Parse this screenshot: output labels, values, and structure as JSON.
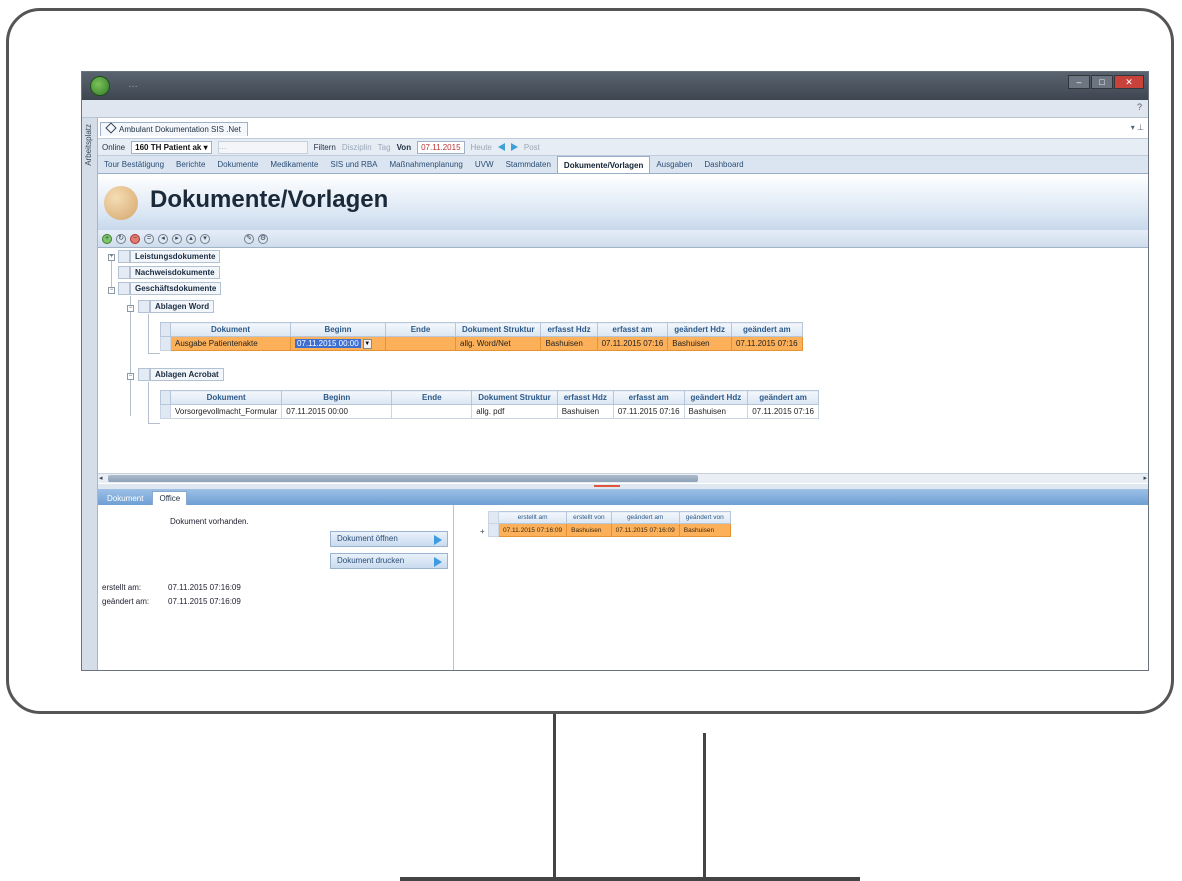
{
  "window": {
    "title_text": "…"
  },
  "ribbon": {
    "help": "?"
  },
  "sidetab": {
    "label": "Arbeitsplatz"
  },
  "doc_tab": {
    "label": "Ambulant Dokumentation SIS .Net"
  },
  "filterbar": {
    "prefix": "Online",
    "patient_value": "160 TH Patient ak",
    "patient_dd": "▾",
    "grayed_value": "…",
    "filter_label": "Filtern",
    "discipline_label": "Disziplin",
    "tag_label": "Tag",
    "von_label": "Von",
    "date_value": "07.11.2015",
    "heute_label": "Heute",
    "post_label": "Post"
  },
  "nav_tabs": [
    {
      "label": "Tour Bestätigung",
      "active": false
    },
    {
      "label": "Berichte",
      "active": false
    },
    {
      "label": "Dokumente",
      "active": false
    },
    {
      "label": "Medikamente",
      "active": false
    },
    {
      "label": "SIS und RBA",
      "active": false
    },
    {
      "label": "Maßnahmenplanung",
      "active": false
    },
    {
      "label": "UVW",
      "active": false
    },
    {
      "label": "Stammdaten",
      "active": false
    },
    {
      "label": "Dokumente/Vorlagen",
      "active": true
    },
    {
      "label": "Ausgaben",
      "active": false
    },
    {
      "label": "Dashboard",
      "active": false
    }
  ],
  "page": {
    "title": "Dokumente/Vorlagen"
  },
  "toolbar": {
    "icons": [
      "add-icon",
      "refresh-icon",
      "delete-icon",
      "print-icon",
      "back-icon",
      "forward-icon",
      "up-icon",
      "down-icon",
      "edit-icon",
      "settings-icon"
    ]
  },
  "tree": {
    "top_nodes": [
      "Leistungsdokumente",
      "Nachweisdokumente",
      "Geschäftsdokumente"
    ],
    "sub_nodes": [
      "Ablagen Word",
      "Ablagen Acrobat"
    ],
    "expander_plus": "+",
    "expander_minus": "−"
  },
  "grid_word": {
    "columns": [
      "Dokument",
      "Beginn",
      "Ende",
      "Dokument Struktur",
      "erfasst Hdz",
      "erfasst am",
      "geändert Hdz",
      "geändert am"
    ],
    "rows": [
      {
        "dokument": "Ausgabe Patientenakte",
        "beginn": "07.11.2015 00:00",
        "ende": "",
        "struktur": "allg. Word/Net",
        "erfasst_hdz": "Bashuisen",
        "erfasst_am": "07.11.2015 07:16",
        "geaendert_hdz": "Bashuisen",
        "geaendert_am": "07.11.2015 07:16"
      }
    ]
  },
  "grid_acrobat": {
    "columns": [
      "Dokument",
      "Beginn",
      "Ende",
      "Dokument Struktur",
      "erfasst Hdz",
      "erfasst am",
      "geändert Hdz",
      "geändert am"
    ],
    "rows": [
      {
        "dokument": "Vorsorgevollmacht_Formular",
        "beginn": "07.11.2015 00:00",
        "ende": "",
        "struktur": "allg. pdf",
        "erfasst_hdz": "Bashuisen",
        "erfasst_am": "07.11.2015 07:16",
        "geaendert_hdz": "Bashuisen",
        "geaendert_am": "07.11.2015 07:16"
      }
    ]
  },
  "bottom_tabs": [
    {
      "label": "Dokument",
      "active": false
    },
    {
      "label": "Office",
      "active": true
    }
  ],
  "office_panel": {
    "status": "Dokument vorhanden.",
    "open_button": "Dokument öffnen",
    "print_button": "Dokument drucken",
    "erstellt_label": "erstellt am:",
    "erstellt_value": "07.11.2015 07:16:09",
    "geaendert_label": "geändert am:",
    "geaendert_value": "07.11.2015 07:16:09"
  },
  "version_grid": {
    "columns": [
      "erstellt am",
      "erstellt von",
      "geändert am",
      "geändert von"
    ],
    "rows": [
      {
        "erstellt_am": "07.11.2015 07:16:09",
        "erstellt_von": "Bashuisen",
        "geaendert_am": "07.11.2015 07:16:09",
        "geaendert_von": "Bashuisen"
      }
    ]
  },
  "colors": {
    "selection": "#fdb05a",
    "accent": "#3fa0d8",
    "title_dark": "#1b2a3a"
  }
}
